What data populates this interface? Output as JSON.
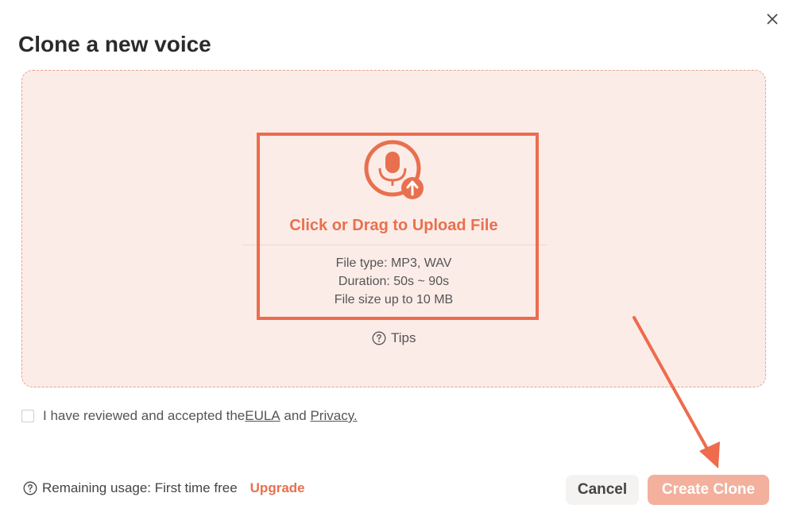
{
  "dialog": {
    "title": "Clone a new voice"
  },
  "dropzone": {
    "upload_label": "Click or Drag to Upload File",
    "file_type": "File type: MP3, WAV",
    "duration": "Duration: 50s ~ 90s",
    "file_size": "File size up to 10 MB",
    "tips_label": "Tips"
  },
  "agreement": {
    "prefix": "I have reviewed and accepted the",
    "eula_link": " EULA",
    "and": " and ",
    "privacy_link": "Privacy."
  },
  "footer": {
    "usage_text": "Remaining usage: First time free",
    "upgrade_label": "Upgrade",
    "cancel_label": "Cancel",
    "create_label": "Create Clone"
  },
  "colors": {
    "accent": "#e8704e",
    "dropzone_bg": "#fcece8",
    "annotation": "#ee6b4d",
    "create_disabled": "#f2b09d"
  }
}
